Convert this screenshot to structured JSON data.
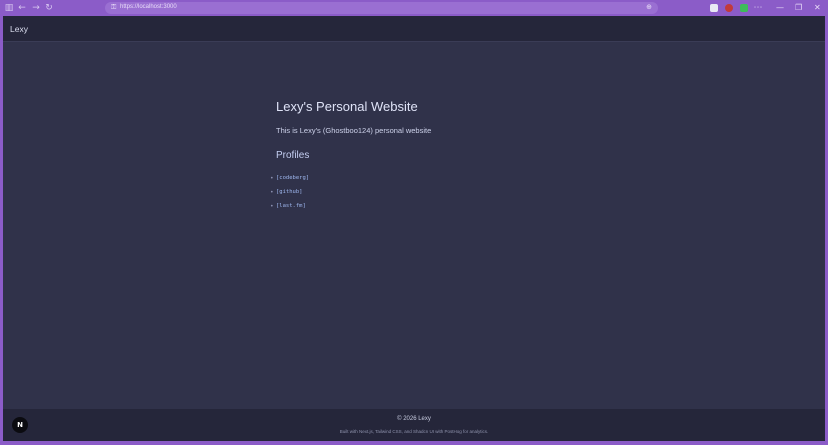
{
  "browser": {
    "url": "https://localhost:3000",
    "back_icon": "back-arrow-icon",
    "forward_icon": "forward-arrow-icon",
    "reload_icon": "reload-icon",
    "window_controls": [
      "—",
      "❐",
      "✕"
    ]
  },
  "nav": {
    "brand": "Lexy"
  },
  "main": {
    "title": "Lexy's Personal Website",
    "description": "This is Lexy's (Ghostboo124) personal website",
    "profiles_heading": "Profiles",
    "profiles": [
      {
        "label": "[codeberg]"
      },
      {
        "label": "[github]"
      },
      {
        "label": "[last.fm]"
      }
    ]
  },
  "footer": {
    "copyright": "© 2026 Lexy",
    "built_with": "Built with Next.js, Tailwind CSS, and Shadcn UI with PostHog for analytics."
  },
  "dev_badge": {
    "label": "N"
  },
  "colors": {
    "chrome": "#8b5cc8",
    "page_bg": "#30324a",
    "bar_bg": "#25263a",
    "link": "#9fb8f0"
  }
}
